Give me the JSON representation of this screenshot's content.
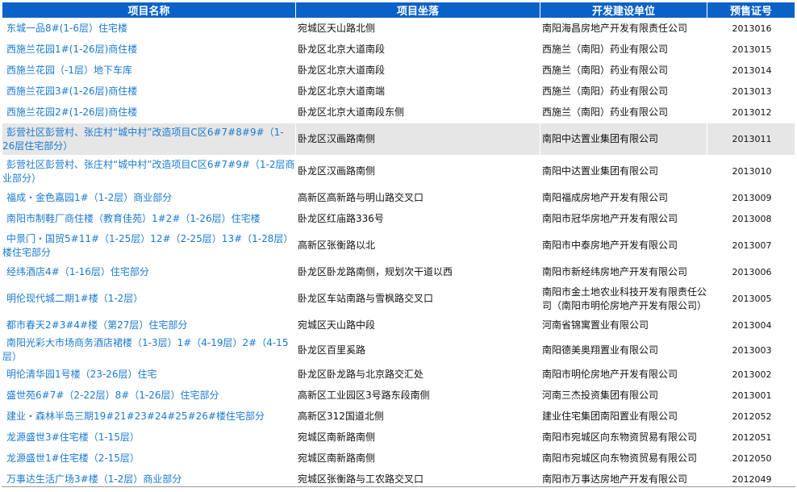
{
  "headers": [
    "项目名称",
    "项目坐落",
    "开发建设单位",
    "预售证号"
  ],
  "rows": [
    {
      "name": "东城一品8#(1-6层）住宅楼",
      "location": "宛城区天山路北侧",
      "developer": "南阳海昌房地产开发有限责任公司",
      "code": "2013016"
    },
    {
      "name": "西施兰花园1#(1-26层)商住楼",
      "location": "卧龙区北京大道南段",
      "developer": "西施兰（南阳）药业有限公司",
      "code": "2013015"
    },
    {
      "name": "西施兰花园（-1层）地下车库",
      "location": "卧龙区北京大道南段",
      "developer": "西施兰（南阳）药业有限公司",
      "code": "2013014"
    },
    {
      "name": "西施兰花园3#(1-26层)商住楼",
      "location": "卧龙区北京大道南端",
      "developer": "西施兰（南阳）药业有限公司",
      "code": "2013013"
    },
    {
      "name": "西施兰花园2#(1-26层)商住楼",
      "location": "卧龙区北京大道南段东侧",
      "developer": "西施兰（南阳）药业有限公司",
      "code": "2013012"
    },
    {
      "name": "彭营社区彭营村、张庄村“城中村”改造项目C区6#7#8#9#（1-26层住宅部分）",
      "location": "卧龙区汉画路南侧",
      "developer": "南阳中达置业集团有限公司",
      "code": "2013011"
    },
    {
      "name": "彭营社区彭营村、张庄村“城中村”改造项目C区6#7#9#（1-2层商业部分）",
      "location": "卧龙区汉画路南侧",
      "developer": "南阳中达置业集团有限公司",
      "code": "2013010"
    },
    {
      "name": "福成・金色嘉园1#（1-2层）商业部分",
      "location": "高新区高新路与明山路交叉口",
      "developer": "南阳福成房地产开发有限公司",
      "code": "2013009"
    },
    {
      "name": "南阳市制鞋厂商住楼（教育佳苑）1#2#（1-26层）住宅楼",
      "location": "卧龙区红庙路336号",
      "developer": "南阳市冠华房地产开发有限公司",
      "code": "2013008"
    },
    {
      "name": "中景门・国贸5#11#（1-25层）12#（2-25层）13#（1-28层）楼住宅部分",
      "location": "高新区张衡路以北",
      "developer": "南阳市中泰房地产开发有限公司",
      "code": "2013007"
    },
    {
      "name": "经纬酒店4#（1-16层）住宅部分",
      "location": "卧龙区卧龙路南侧，规划次干道以西",
      "developer": "南阳市新经纬房地产开发有限公司",
      "code": "2013006"
    },
    {
      "name": "明伦现代城二期1#楼（1-2层）",
      "location": "卧龙区车站南路与雪枫路交叉口",
      "developer": "南阳市金土地农业科技开发有限责任公司（南阳市明伦房地产开发有限公司）",
      "code": "2013005"
    },
    {
      "name": "都市春天2#3#4#楼（第27层）住宅部分",
      "location": "宛城区天山路中段",
      "developer": "河南省锦寓置业有限公司",
      "code": "2013004"
    },
    {
      "name": "南阳光彩大市场商务酒店裙楼（1-3层）1#（4-19层）2#（4-15层）",
      "location": "卧龙区百里奚路",
      "developer": "南阳德美奥翔置业有限公司",
      "code": "2013003"
    },
    {
      "name": "明伦清华园1号楼（23-26层）住宅",
      "location": "卧龙区卧龙路与北京路交汇处",
      "developer": "南阳市明伦房地产开发有限公司",
      "code": "2013002"
    },
    {
      "name": "盛世苑6#7#（2-22层）8#（1-26层）住宅部分",
      "location": "高新区工业园区3号路东段南侧",
      "developer": "河南三杰投资集团有限公司",
      "code": "2013001"
    },
    {
      "name": "建业・森林半岛三期19#21#23#24#25#26#楼住宅部分",
      "location": "高新区312国道北侧",
      "developer": "建业住宅集团南阳置业有限公司",
      "code": "2012052"
    },
    {
      "name": "龙源盛世3#住宅楼（1-15层）",
      "location": "宛城区南新路南侧",
      "developer": "南阳市宛城区向东物资贸易有限公司",
      "code": "2012051"
    },
    {
      "name": "龙源盛世1#住宅楼（2-15层）",
      "location": "宛城区南新路南侧",
      "developer": "南阳市宛城区向东物资贸易有限公司",
      "code": "2012050"
    },
    {
      "name": "万事达生活广场3#楼（1-2层）商业部分",
      "location": "宛城区张衡路与工农路交叉口",
      "developer": "南阳市万事达房地产开发有限公司",
      "code": "2012049"
    }
  ]
}
